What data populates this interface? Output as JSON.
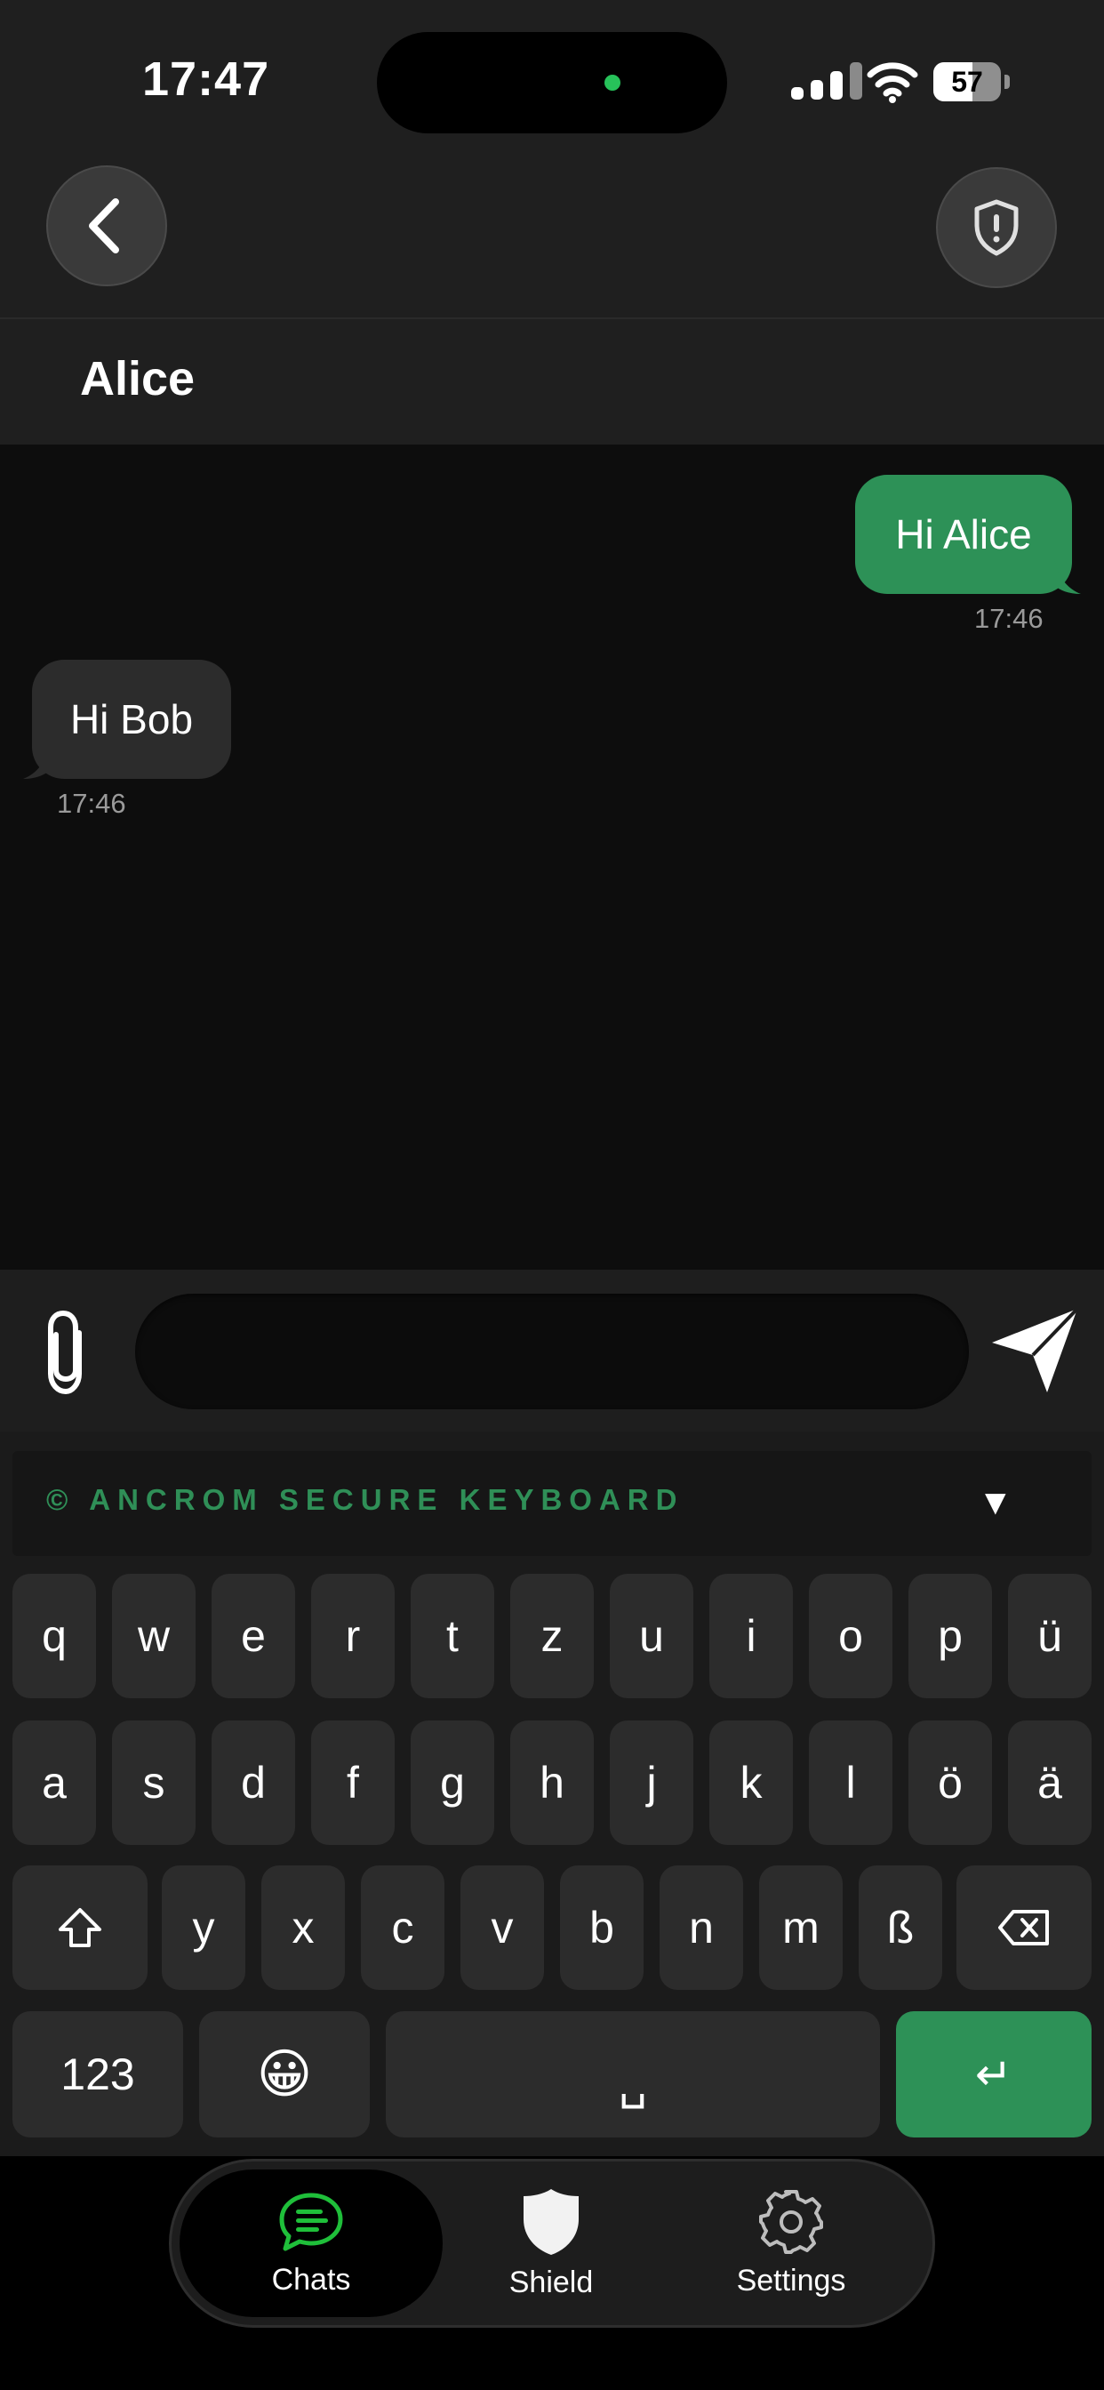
{
  "status_bar": {
    "time": "17:47",
    "battery": "57"
  },
  "header": {
    "title": "Alice"
  },
  "messages": [
    {
      "direction": "outgoing",
      "text": "Hi Alice",
      "time": "17:46"
    },
    {
      "direction": "incoming",
      "text": "Hi Bob",
      "time": "17:46"
    }
  ],
  "composer": {
    "placeholder": ""
  },
  "keyboard": {
    "banner": "© ANCROM SECURE KEYBOARD",
    "collapse": "▼",
    "row1": [
      "q",
      "w",
      "e",
      "r",
      "t",
      "z",
      "u",
      "i",
      "o",
      "p",
      "ü"
    ],
    "row2": [
      "a",
      "s",
      "d",
      "f",
      "g",
      "h",
      "j",
      "k",
      "l",
      "ö",
      "ä"
    ],
    "row3": [
      "y",
      "x",
      "c",
      "v",
      "b",
      "n",
      "m",
      "ß"
    ],
    "numbers_key": "123",
    "emoji_key": "😀",
    "space_key": "␣",
    "return_key": "↵"
  },
  "tabs": [
    {
      "label": "Chats",
      "icon": "chat-bubble-icon",
      "active": true
    },
    {
      "label": "Shield",
      "icon": "shield-icon",
      "active": false
    },
    {
      "label": "Settings",
      "icon": "gear-icon",
      "active": false
    }
  ],
  "colors": {
    "accent_green": "#2d9157",
    "tab_active_green": "#1fbf3a",
    "background": "#0d0d0d",
    "header": "#1f1f1f"
  }
}
